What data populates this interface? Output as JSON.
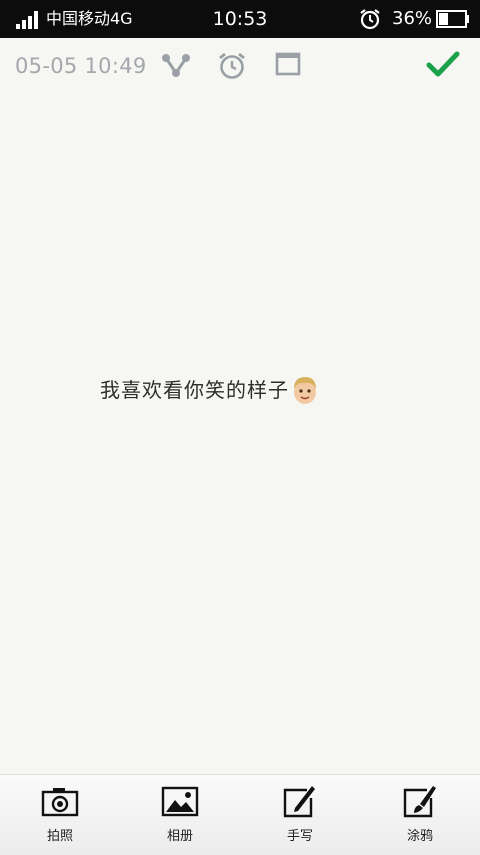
{
  "status_bar": {
    "carrier": "中国移动4G",
    "time": "10:53",
    "battery": "36%",
    "battery_level": 0.36
  },
  "toolbar": {
    "datetime": "05-05 10:49",
    "icons": [
      "share-icon",
      "alarm-clock-icon",
      "window-icon",
      "checkmark-icon"
    ],
    "accent_color": "#1ba14a"
  },
  "note": {
    "text": "我喜欢看你笑的样子",
    "emoji": "boy-face-emoji"
  },
  "bottom_bar": {
    "items": [
      {
        "label": "拍照",
        "icon": "camera-icon"
      },
      {
        "label": "相册",
        "icon": "picture-icon"
      },
      {
        "label": "手写",
        "icon": "handwrite-icon"
      },
      {
        "label": "涂鸦",
        "icon": "brush-icon"
      }
    ]
  }
}
